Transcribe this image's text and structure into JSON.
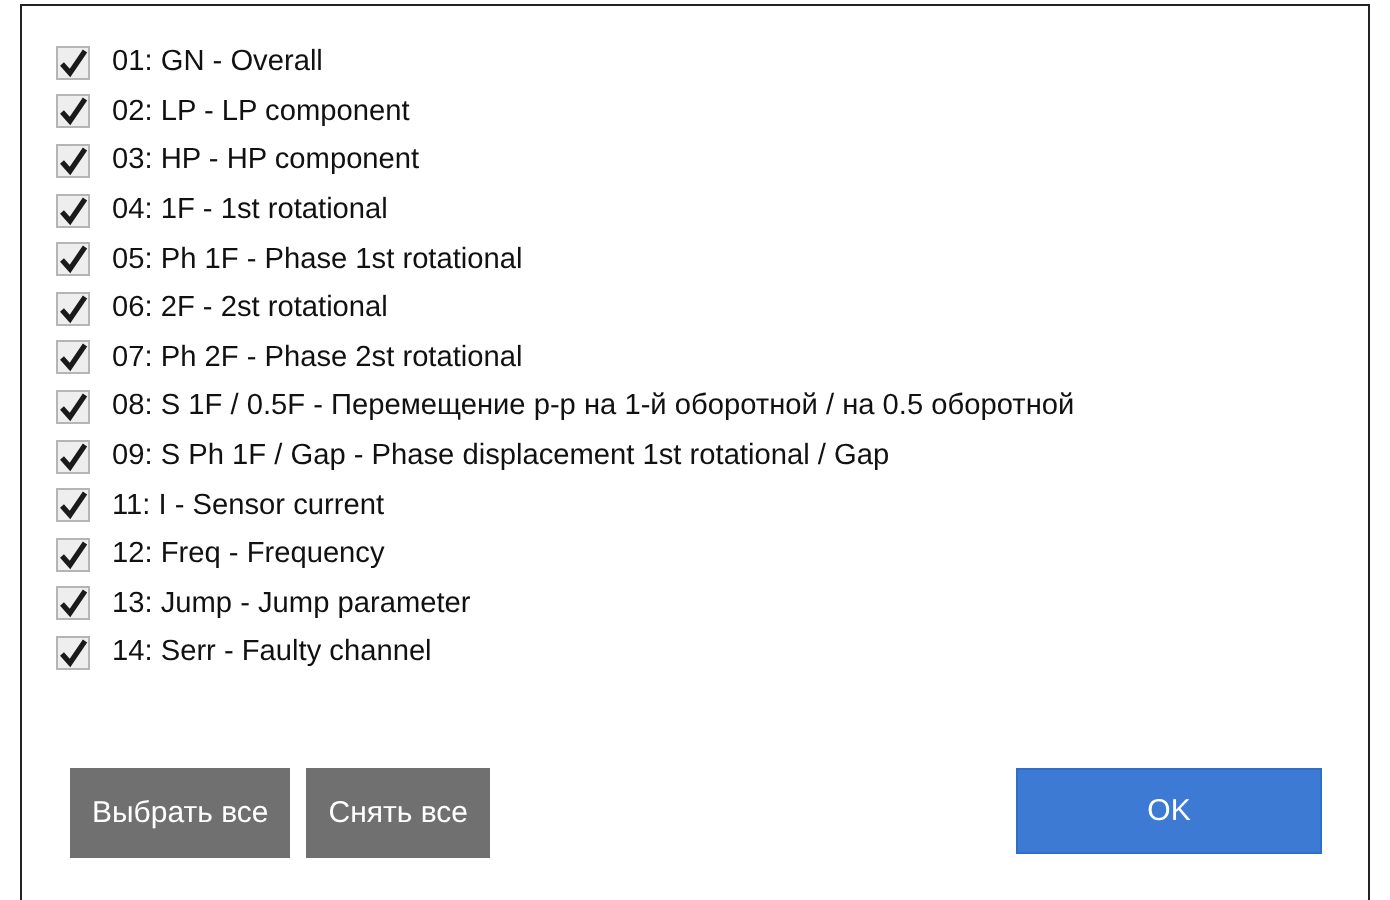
{
  "items": [
    {
      "label": "01: GN - Overall",
      "checked": true
    },
    {
      "label": "02: LP - LP component",
      "checked": true
    },
    {
      "label": "03: HP - HP component",
      "checked": true
    },
    {
      "label": "04: 1F - 1st rotational",
      "checked": true
    },
    {
      "label": "05: Ph 1F - Phase 1st rotational",
      "checked": true
    },
    {
      "label": "06: 2F - 2st rotational",
      "checked": true
    },
    {
      "label": "07: Ph 2F - Phase 2st rotational",
      "checked": true
    },
    {
      "label": "08: S 1F / 0.5F - Перемещение р-р на 1-й оборотной / на 0.5 оборотной",
      "checked": true
    },
    {
      "label": "09: S Ph 1F / Gap - Phase displacement 1st rotational / Gap",
      "checked": true
    },
    {
      "label": "11: I - Sensor current",
      "checked": true
    },
    {
      "label": "12: Freq - Frequency",
      "checked": true
    },
    {
      "label": "13: Jump - Jump parameter",
      "checked": true
    },
    {
      "label": "14: Serr - Faulty channel",
      "checked": true
    }
  ],
  "buttons": [
    {
      "label": "Выбрать все",
      "kind": "secondary"
    },
    {
      "label": "Снять все",
      "kind": "secondary"
    },
    {
      "label": "OK",
      "kind": "primary"
    }
  ]
}
